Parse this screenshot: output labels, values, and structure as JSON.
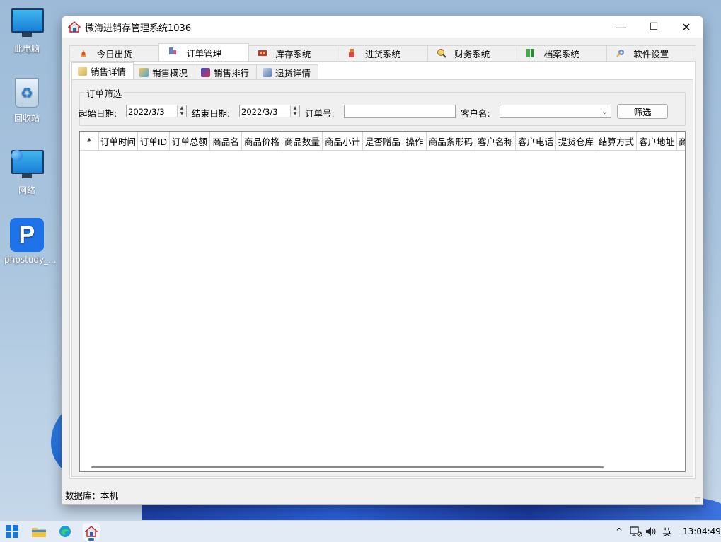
{
  "desktop": {
    "icons": [
      {
        "label": "此电脑",
        "icon": "computer-icon"
      },
      {
        "label": "回收站",
        "icon": "recycle-bin-icon"
      },
      {
        "label": "网络",
        "icon": "network-icon"
      },
      {
        "label": "phpstudy_...",
        "icon": "phpstudy-icon"
      }
    ],
    "phpstudy_glyph": "P"
  },
  "window": {
    "title": "微海进销存管理系统1036",
    "controls": {
      "minimize": "—",
      "maximize": "☐",
      "close": "✕"
    },
    "main_tabs": [
      {
        "label": "今日出货",
        "icon": "shipping-icon"
      },
      {
        "label": "订单管理",
        "icon": "order-icon"
      },
      {
        "label": "库存系统",
        "icon": "inventory-icon"
      },
      {
        "label": "进货系统",
        "icon": "purchase-icon"
      },
      {
        "label": "财务系统",
        "icon": "finance-icon"
      },
      {
        "label": "档案系统",
        "icon": "archive-icon"
      },
      {
        "label": "软件设置",
        "icon": "settings-icon"
      }
    ],
    "active_main_tab": "订单管理",
    "sub_tabs": [
      {
        "label": "销售详情",
        "icon": "sales-detail-icon"
      },
      {
        "label": "销售概况",
        "icon": "sales-overview-icon"
      },
      {
        "label": "销售排行",
        "icon": "sales-ranking-icon"
      },
      {
        "label": "退货详情",
        "icon": "returns-icon"
      }
    ],
    "active_sub_tab": "销售详情",
    "filter": {
      "legend": "订单筛选",
      "start_label": "起始日期:",
      "start_value": "2022/3/3",
      "end_label": "结束日期:",
      "end_value": "2022/3/3",
      "order_no_label": "订单号:",
      "order_no_value": "",
      "customer_label": "客户名:",
      "customer_value": "",
      "button": "筛选"
    },
    "grid": {
      "columns": [
        "*",
        "订单时间",
        "订单ID",
        "订单总额",
        "商品名",
        "商品价格",
        "商品数量",
        "商品小计",
        "是否赠品",
        "操作",
        "商品条形码",
        "客户名称",
        "客户电话",
        "提货仓库",
        "结算方式",
        "客户地址",
        "商品"
      ],
      "rows": []
    },
    "status": "数据库：本机"
  },
  "taskbar": {
    "tray_chevron": "^",
    "ime": "英",
    "time": "13:04:49"
  },
  "colors": {
    "accent": "#1a6fd6",
    "window_bg": "#f0f0f0",
    "taskbar_bg": "#e3ecf6"
  }
}
